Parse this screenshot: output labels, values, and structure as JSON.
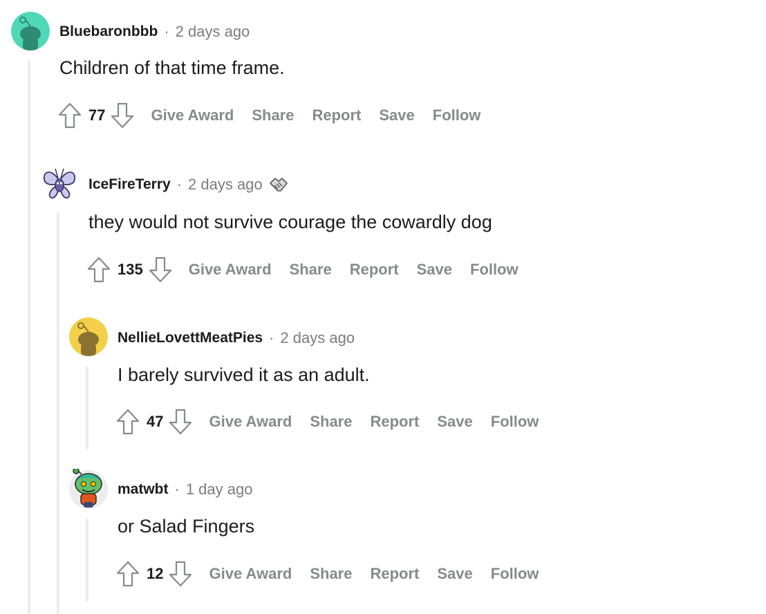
{
  "comments": [
    {
      "author": "Bluebaronbbb",
      "separator": "·",
      "time": "2 days ago",
      "body": "Children of that time frame.",
      "score": "77",
      "actions": [
        "Give Award",
        "Share",
        "Report",
        "Save",
        "Follow"
      ],
      "avatar_color": "#4fd8b8",
      "avatar_icon": "snoo-avatar-icon"
    },
    {
      "author": "IceFireTerry",
      "separator": "·",
      "time": "2 days ago",
      "award_icon": "handshake-award-icon",
      "body": "they would not survive courage the cowardly dog",
      "score": "135",
      "actions": [
        "Give Award",
        "Share",
        "Report",
        "Save",
        "Follow"
      ],
      "avatar_icon": "butterfly-avatar-icon"
    },
    {
      "author": "NellieLovettMeatPies",
      "separator": "·",
      "time": "2 days ago",
      "body": "I barely survived it as an adult.",
      "score": "47",
      "actions": [
        "Give Award",
        "Share",
        "Report",
        "Save",
        "Follow"
      ],
      "avatar_color": "#f2d049",
      "avatar_icon": "snoo-avatar-icon"
    },
    {
      "author": "matwbt",
      "separator": "·",
      "time": "1 day ago",
      "body": "or Salad Fingers",
      "score": "12",
      "actions": [
        "Give Award",
        "Share",
        "Report",
        "Save",
        "Follow"
      ],
      "avatar_color": "#ececec",
      "avatar_icon": "zombie-snoo-avatar-icon"
    }
  ],
  "colors": {
    "text": "#1c1c1c",
    "muted": "#878a8c",
    "thread_line": "#ededed"
  }
}
